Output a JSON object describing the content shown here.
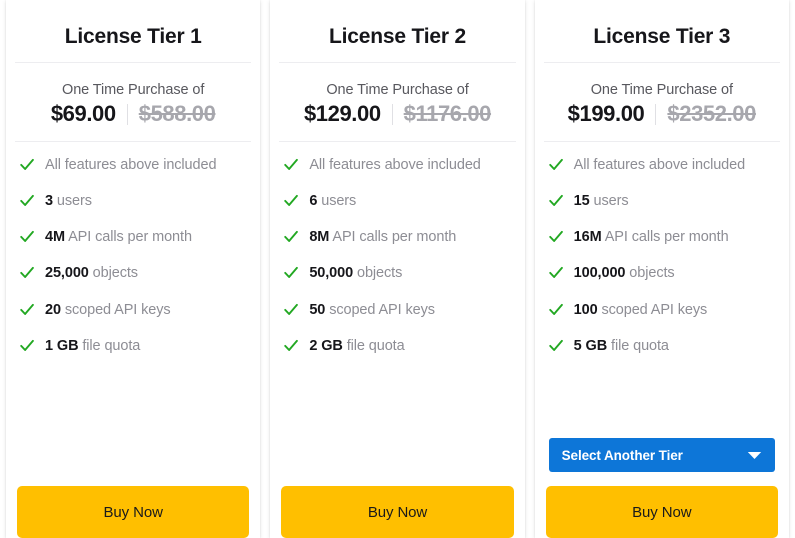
{
  "theme": {
    "accent_blue": "#0d76d8",
    "buy_amber": "#FFBF00",
    "check_green": "#22a822",
    "text_dark": "#16161a",
    "text_muted": "#8d8d94"
  },
  "cards": [
    {
      "title": "License Tier 1",
      "price_lead": "One Time Purchase of",
      "price_current": "$69.00",
      "price_original": "$588.00",
      "features": [
        {
          "emph": "",
          "rest": "All features above included"
        },
        {
          "emph": "3",
          "rest": " users"
        },
        {
          "emph": "4M",
          "rest": " API calls per month"
        },
        {
          "emph": "25,000",
          "rest": " objects"
        },
        {
          "emph": "20",
          "rest": " scoped API keys"
        },
        {
          "emph": "1 GB",
          "rest": " file quota"
        }
      ],
      "has_select": false,
      "select_label": "",
      "buy_label": "Buy Now"
    },
    {
      "title": "License Tier 2",
      "price_lead": "One Time Purchase of",
      "price_current": "$129.00",
      "price_original": "$1176.00",
      "features": [
        {
          "emph": "",
          "rest": "All features above included"
        },
        {
          "emph": "6",
          "rest": " users"
        },
        {
          "emph": "8M",
          "rest": " API calls per month"
        },
        {
          "emph": "50,000",
          "rest": " objects"
        },
        {
          "emph": "50",
          "rest": " scoped API keys"
        },
        {
          "emph": "2 GB",
          "rest": " file quota"
        }
      ],
      "has_select": false,
      "select_label": "",
      "buy_label": "Buy Now"
    },
    {
      "title": "License Tier 3",
      "price_lead": "One Time Purchase of",
      "price_current": "$199.00",
      "price_original": "$2352.00",
      "features": [
        {
          "emph": "",
          "rest": "All features above included"
        },
        {
          "emph": "15",
          "rest": " users"
        },
        {
          "emph": "16M",
          "rest": " API calls per month"
        },
        {
          "emph": "100,000",
          "rest": " objects"
        },
        {
          "emph": "100",
          "rest": " scoped API keys"
        },
        {
          "emph": "5 GB",
          "rest": " file quota"
        }
      ],
      "has_select": true,
      "select_label": "Select Another Tier",
      "buy_label": "Buy Now"
    }
  ],
  "icons": {
    "check": "check-icon",
    "caret": "chevron-down-icon"
  }
}
